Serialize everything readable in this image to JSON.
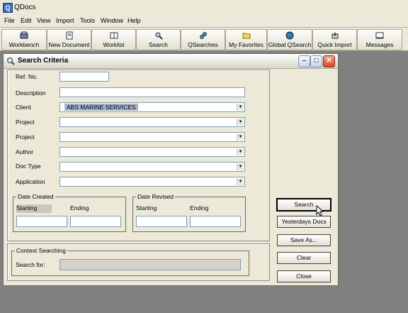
{
  "app": {
    "title": "QDocs"
  },
  "menu": [
    "File",
    "Edit",
    "View",
    "Import",
    "Tools",
    "Window",
    "Help"
  ],
  "toolbar": [
    {
      "label": "Workbench",
      "icon": "workbench-icon"
    },
    {
      "label": "New Document",
      "icon": "new-document-icon"
    },
    {
      "label": "Worklist",
      "icon": "worklist-icon"
    },
    {
      "label": "Search",
      "icon": "search-icon"
    },
    {
      "label": "QSearches",
      "icon": "qsearches-icon"
    },
    {
      "label": "My Favorites",
      "icon": "favorites-folder-icon"
    },
    {
      "label": "Global QSearch",
      "icon": "globe-icon"
    },
    {
      "label": "Quick Import",
      "icon": "quick-import-icon"
    },
    {
      "label": "Messages",
      "icon": "messages-icon"
    }
  ],
  "window": {
    "title": "Search Criteria",
    "fields": {
      "ref_no": {
        "label": "Ref. No.",
        "value": ""
      },
      "description": {
        "label": "Description",
        "value": ""
      },
      "client": {
        "label": "Client",
        "value": "ABS MARINE SERVICES"
      },
      "project1": {
        "label": "Project",
        "value": ""
      },
      "project2": {
        "label": "Project",
        "value": ""
      },
      "author": {
        "label": "Author",
        "value": ""
      },
      "doc_type": {
        "label": "Doc Type",
        "value": ""
      },
      "application": {
        "label": "Application",
        "value": ""
      }
    },
    "date_created": {
      "title": "Date Created",
      "starting": "Starting",
      "ending": "Ending"
    },
    "date_revised": {
      "title": "Date Revised",
      "starting": "Starting",
      "ending": "Ending"
    },
    "context": {
      "title": "Context Searching",
      "search_for_label": "Search for:",
      "value": ""
    },
    "buttons": {
      "search": "Search",
      "yesterdays": "Yesterdays Docs",
      "save_as": "Save As...",
      "clear": "Clear",
      "close": "Close"
    }
  }
}
